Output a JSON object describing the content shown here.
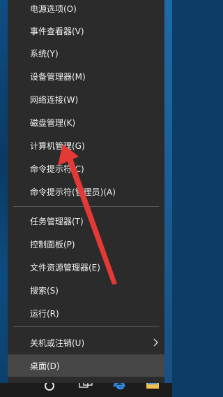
{
  "menu": {
    "items": [
      {
        "label": "电源选项(O)"
      },
      {
        "label": "事件查看器(V)"
      },
      {
        "label": "系统(Y)"
      },
      {
        "label": "设备管理器(M)"
      },
      {
        "label": "网络连接(W)"
      },
      {
        "label": "磁盘管理(K)"
      },
      {
        "label": "计算机管理(G)"
      },
      {
        "label": "命令提示符(C)"
      },
      {
        "label": "命令提示符(管理员)(A)"
      },
      {
        "label": "任务管理器(T)"
      },
      {
        "label": "控制面板(P)"
      },
      {
        "label": "文件资源管理器(E)"
      },
      {
        "label": "搜索(S)"
      },
      {
        "label": "运行(R)"
      },
      {
        "label": "关机或注销(U)"
      },
      {
        "label": "桌面(D)"
      }
    ]
  },
  "colors": {
    "menu_background": "#2b2b2b",
    "highlight": "#474747",
    "annotation_arrow": "#e53935"
  }
}
